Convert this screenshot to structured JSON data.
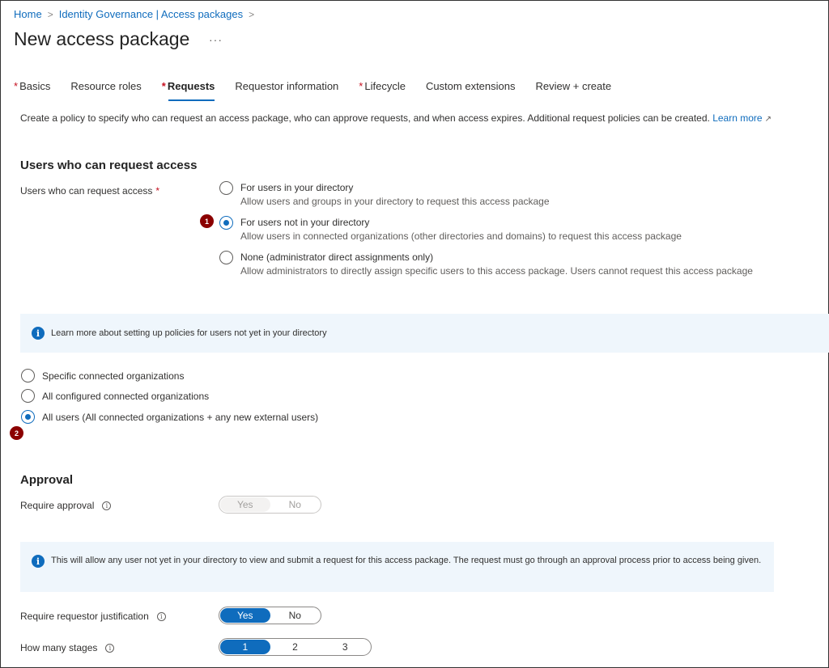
{
  "breadcrumb": {
    "items": [
      "Home",
      "Identity Governance | Access packages"
    ]
  },
  "header": {
    "title": "New access package",
    "more_label": "···"
  },
  "tabs": [
    {
      "label": "Basics",
      "required": true,
      "active": false
    },
    {
      "label": "Resource roles",
      "required": false,
      "active": false
    },
    {
      "label": "Requests",
      "required": true,
      "active": true
    },
    {
      "label": "Requestor information",
      "required": false,
      "active": false
    },
    {
      "label": "Lifecycle",
      "required": true,
      "active": false
    },
    {
      "label": "Custom extensions",
      "required": false,
      "active": false
    },
    {
      "label": "Review + create",
      "required": false,
      "active": false
    }
  ],
  "description": {
    "text": "Create a policy to specify who can request an access package, who can approve requests, and when access expires. Additional request policies can be created.",
    "link": "Learn more"
  },
  "who_section": {
    "title": "Users who can request access",
    "field_label": "Users who can request access",
    "required_mark": "*",
    "options": [
      {
        "label": "For users in your directory",
        "description": "Allow users and groups in your directory to request this access package",
        "selected": false
      },
      {
        "label": "For users not in your directory",
        "description": "Allow users in connected organizations (other directories and domains) to request this access package",
        "selected": true
      },
      {
        "label": "None (administrator direct assignments only)",
        "description": "Allow administrators to directly assign specific users to this access package. Users cannot request this access package",
        "selected": false
      }
    ],
    "step1": "1"
  },
  "info1": {
    "icon": "i",
    "text": "Learn more about setting up policies for users not yet in your directory"
  },
  "scope_options": [
    {
      "label": "Specific connected organizations",
      "selected": false
    },
    {
      "label": "All configured connected organizations",
      "selected": false
    },
    {
      "label": "All users (All connected organizations + any new external users)",
      "selected": true
    }
  ],
  "step2": "2",
  "approval": {
    "title": "Approval",
    "require_approval_label": "Require approval",
    "require_approval": {
      "options": [
        "Yes",
        "No"
      ],
      "selected": "Yes",
      "disabled": true
    },
    "info_text": "This will allow any user not yet in your directory to view and submit a request for this access package. The request must go through an approval process prior to access being given.",
    "justification_label": "Require requestor justification",
    "justification": {
      "options": [
        "Yes",
        "No"
      ],
      "selected": "Yes"
    },
    "stages_label": "How many stages",
    "stages": {
      "options": [
        "1",
        "2",
        "3"
      ],
      "selected": "1"
    }
  },
  "colors": {
    "accent": "#0f6cbd",
    "required": "#c50f1f",
    "step_badge": "#8b0000",
    "info_bg": "#eff6fc"
  }
}
